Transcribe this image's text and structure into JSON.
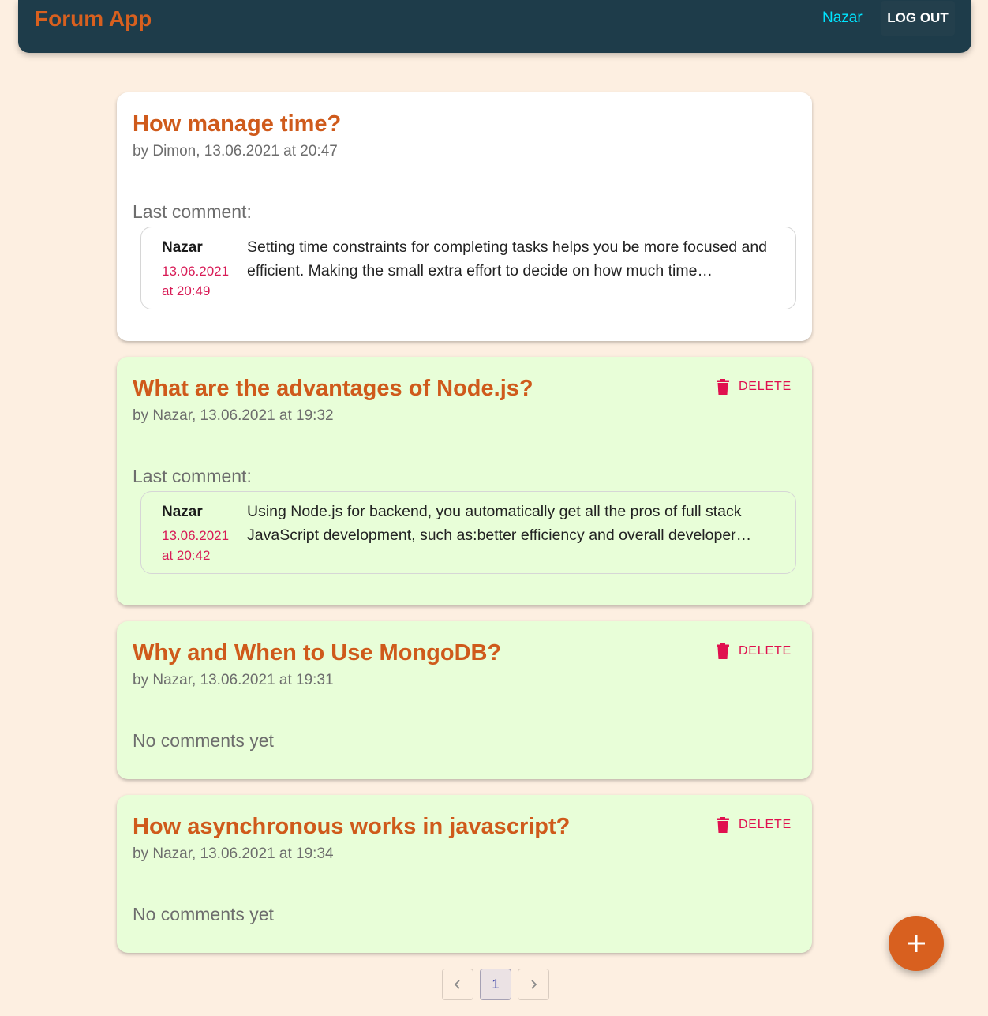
{
  "header": {
    "brand": "Forum App",
    "user": "Nazar",
    "logout_label": "LOG OUT"
  },
  "posts": [
    {
      "title": "How manage time?",
      "meta": "by Dimon, 13.06.2021 at 20:47",
      "section_label": "Last comment:",
      "delete_label": "",
      "comment": {
        "author": "Nazar",
        "date": "13.06.2021 at 20:49",
        "text": "Setting time constraints for completing tasks helps you be more focused and efficient. Making the small extra effort to decide on how much time…"
      }
    },
    {
      "title": "What are the advantages of Node.js?",
      "meta": "by Nazar, 13.06.2021 at 19:32",
      "section_label": "Last comment:",
      "delete_label": "DELETE",
      "comment": {
        "author": "Nazar",
        "date": "13.06.2021 at 20:42",
        "text": "Using Node.js for backend, you automatically get all the pros of full stack JavaScript development, such as:better efficiency and overall developer…"
      }
    },
    {
      "title": "Why and When to Use MongoDB?",
      "meta": "by Nazar, 13.06.2021 at 19:31",
      "section_label": "No comments yet",
      "delete_label": "DELETE"
    },
    {
      "title": "How asynchronous works in javascript?",
      "meta": "by Nazar, 13.06.2021 at 19:34",
      "section_label": "No comments yet",
      "delete_label": "DELETE"
    }
  ],
  "pagination": {
    "prev_icon": "chevron-left-icon",
    "current_page": "1",
    "next_icon": "chevron-right-icon"
  },
  "fab": {
    "icon": "plus-icon"
  },
  "colors": {
    "background": "#fdefe1",
    "appbar": "#1e3c4a",
    "accent": "#d8601f",
    "own_post_card": "#e8fed8",
    "delete": "#e0104f"
  }
}
